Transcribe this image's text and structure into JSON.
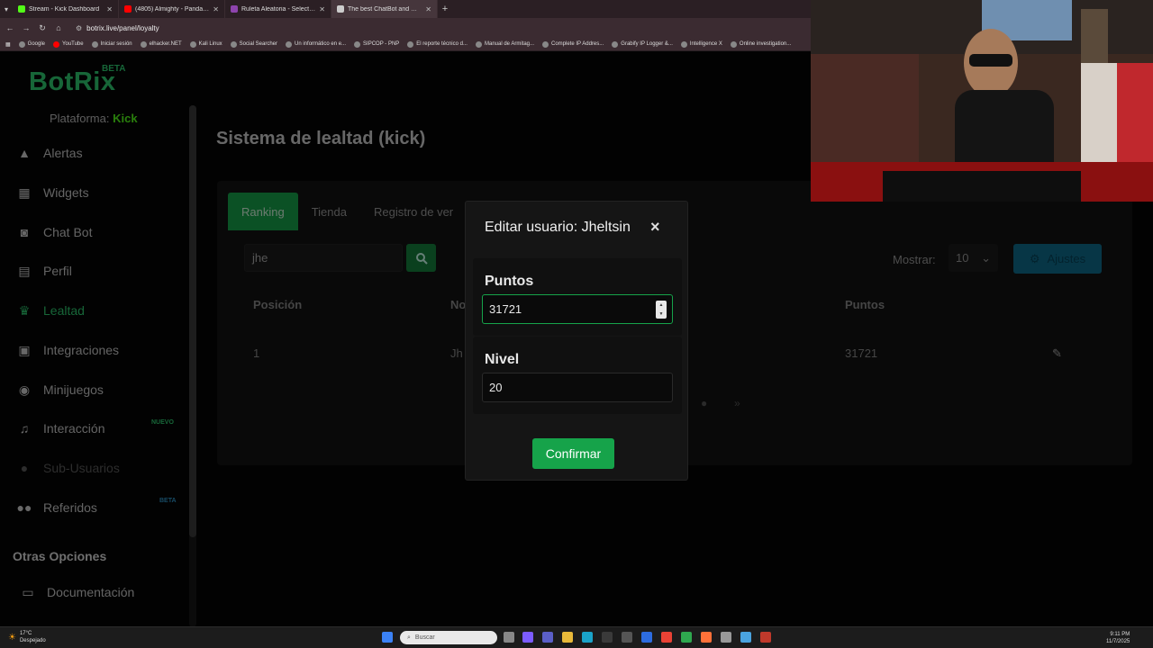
{
  "browser": {
    "tabs": [
      {
        "title": "Stream - Kick Dashboard",
        "color": "#53fc18"
      },
      {
        "title": "(4805) Almighty - Panda Ft...",
        "color": "#ff0000"
      },
      {
        "title": "Ruleta Aleatoria - Selector Pers...",
        "color": "#8e44ad"
      },
      {
        "title": "The best ChatBot and Widgets...",
        "color": "#cccccc"
      }
    ],
    "url": "botrix.live/panel/loyalty",
    "bookmarks": [
      "Google",
      "YouTube",
      "Iniciar sesión",
      "elhacker.NET",
      "Kali Linux",
      "Social Searcher",
      "Un informático en e...",
      "SIPCOP - PNP",
      "El reporte técnico d...",
      "Manual de Armitag...",
      "Complete IP Addres...",
      "Grabify IP Logger &...",
      "Intelligence X",
      "Online investigation..."
    ]
  },
  "sidebar": {
    "brand": "BotRix",
    "brand_tag": "BETA",
    "platform_label": "Plataforma:",
    "platform_value": "Kick",
    "items": [
      {
        "label": "Alertas",
        "icon": "warning-icon"
      },
      {
        "label": "Widgets",
        "icon": "grid-icon"
      },
      {
        "label": "Chat Bot",
        "icon": "robot-icon"
      },
      {
        "label": "Perfil",
        "icon": "id-card-icon"
      },
      {
        "label": "Lealtad",
        "icon": "trophy-icon"
      },
      {
        "label": "Integraciones",
        "icon": "integrations-icon"
      },
      {
        "label": "Minijuegos",
        "icon": "gamepad-icon"
      },
      {
        "label": "Interacción",
        "icon": "music-icon"
      },
      {
        "label": "Sub-Usuarios",
        "icon": "users-icon"
      },
      {
        "label": "Referidos",
        "icon": "referrals-icon"
      }
    ],
    "new_tag": "NUEVO",
    "beta_tag": "BETA",
    "section_title": "Otras Opciones",
    "docs_label": "Documentación"
  },
  "main": {
    "title": "Sistema de lealtad (kick)",
    "tabs": [
      "Ranking",
      "Tienda",
      "Registro de ver"
    ],
    "search_value": "jhe",
    "show_label": "Mostrar:",
    "show_value": "10",
    "settings_label": "Ajustes",
    "columns": [
      "Posición",
      "No",
      "Puntos"
    ],
    "rows": [
      {
        "position": "1",
        "name": "Jh",
        "points": "31721"
      }
    ],
    "pager_next": "»"
  },
  "modal": {
    "title": "Editar usuario: Jheltsin",
    "close": "×",
    "points_label": "Puntos",
    "points_value": "31721",
    "level_label": "Nivel",
    "level_value": "20",
    "confirm_label": "Confirmar"
  },
  "taskbar": {
    "weather_temp": "17°C",
    "weather_desc": "Despejado",
    "search_placeholder": "Buscar",
    "time": "9:11 PM",
    "date": "11/7/2025"
  },
  "colors": {
    "accent": "#16a34a",
    "brand": "#2ecc71",
    "kick": "#53fc18",
    "settings_button": "#0e6d8d"
  }
}
